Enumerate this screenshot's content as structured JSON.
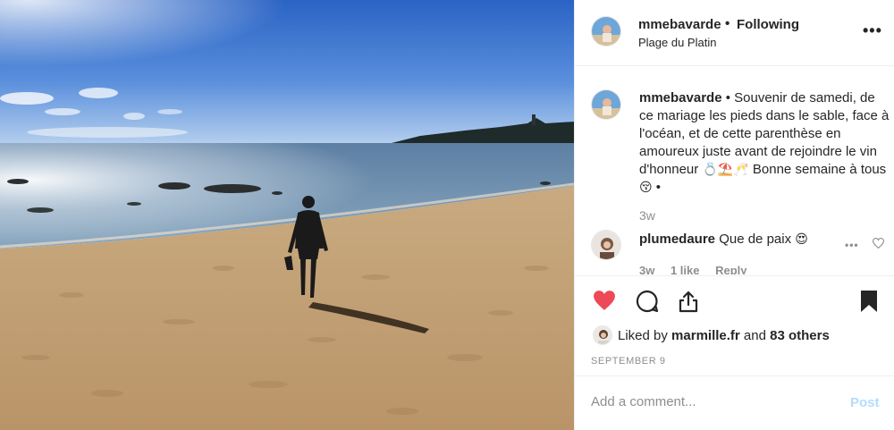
{
  "header": {
    "username": "mmebavarde",
    "separator": "•",
    "follow_status": "Following",
    "location": "Plage du Platin",
    "more": "•••"
  },
  "caption": {
    "username": "mmebavarde",
    "text_part1": " • Souvenir de samedi, de ce mariage les pieds dans le sable, face à l'océan, et de cette parenthèse en amoureux juste avant de rejoindre le vin d'honneur ",
    "emojis_1": "💍⛱️🥂",
    "text_part2": " Bonne semaine à tous ",
    "emojis_2": "😚",
    "text_part3": " •",
    "time": "3w"
  },
  "comment": {
    "username": "plumedaure",
    "text": " Que de paix ",
    "emoji": "😍",
    "more": "•••",
    "time": "3w",
    "likes": "1 like",
    "reply": "Reply"
  },
  "likes": {
    "prefix": "Liked by ",
    "liker": "marmille.fr",
    "middle": " and ",
    "others": "83 others"
  },
  "date": "SEPTEMBER 9",
  "add_comment": {
    "placeholder": "Add a comment...",
    "post_label": "Post"
  },
  "colors": {
    "heart": "#ed4956",
    "post_disabled": "#b3dbff",
    "secondary_text": "#8e8e8e"
  },
  "icons": [
    "heart-icon",
    "comment-icon",
    "share-icon",
    "bookmark-icon",
    "more-icon"
  ]
}
